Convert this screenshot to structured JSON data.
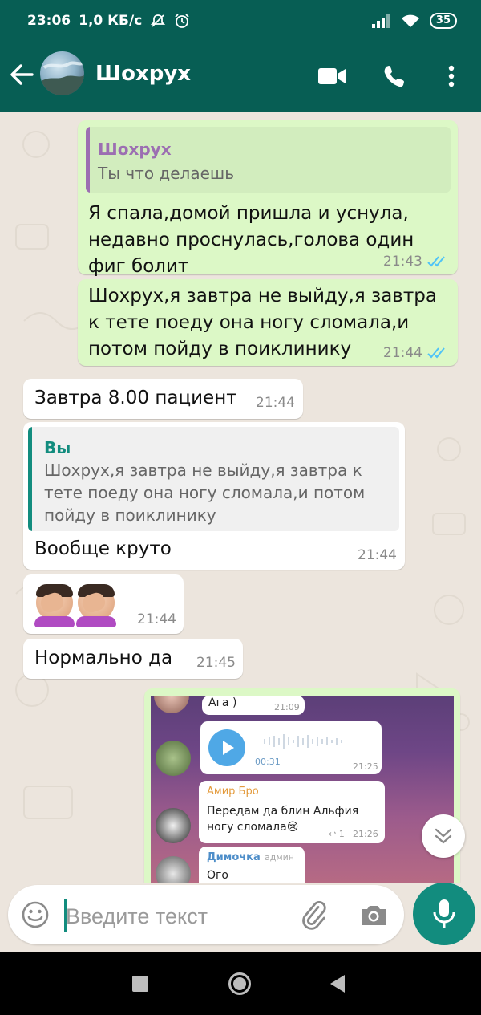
{
  "status_bar": {
    "time": "23:06",
    "speed": "1,0 КБ/с",
    "battery": "35",
    "icons": [
      "muted-bell-icon",
      "alarm-icon",
      "signal-icon",
      "wifi-icon",
      "battery-icon"
    ]
  },
  "header": {
    "contact_name": "Шохрух",
    "icons": [
      "back-arrow-icon",
      "video-call-icon",
      "phone-icon",
      "more-icon"
    ]
  },
  "messages": [
    {
      "direction": "out",
      "quote": {
        "author": "Шохрух",
        "text": "Ты что делаешь"
      },
      "lines": [
        "Я спала,домой пришла и уснула,",
        "недавно проснулась,голова один",
        "фиг болит"
      ],
      "time": "21:43",
      "status": "read"
    },
    {
      "direction": "out",
      "lines": [
        "Шохрух,я завтра не выйду,я завтра",
        "к тете поеду она ногу сломала,и",
        "потом пойду в поиклинику"
      ],
      "time": "21:44",
      "status": "read"
    },
    {
      "direction": "in",
      "text": "Завтра 8.00 пациент",
      "time": "21:44"
    },
    {
      "direction": "in",
      "quote": {
        "author": "Вы",
        "lines": [
          "Шохрух,я завтра не выйду,я завтра к",
          "тете поеду она ногу сломала,и потом",
          "пойду в поиклинику"
        ]
      },
      "text": "Вообще круто",
      "time": "21:44"
    },
    {
      "direction": "in",
      "emoji": [
        "face-palm",
        "face-palm"
      ],
      "time": "21:44"
    },
    {
      "direction": "in",
      "text": "Нормально да",
      "time": "21:45"
    }
  ],
  "forwarded_image": {
    "messages": [
      {
        "text": "Ага )",
        "time": "21:09"
      },
      {
        "voice_duration": "00:31",
        "time": "21:25"
      },
      {
        "author": "Амир Бро",
        "lines": [
          "Передам  да блин Альфия",
          "ногу сломала😢"
        ],
        "reply_count": "1",
        "time": "21:26"
      },
      {
        "author": "Димочка",
        "role": "админ",
        "text": "Ого"
      }
    ],
    "colors": {
      "author_amir": "#E39A3B",
      "author_dima": "#4E8EC9"
    }
  },
  "input": {
    "placeholder": "Введите текст",
    "icons": [
      "emoji-icon",
      "attach-icon",
      "camera-icon",
      "mic-icon"
    ]
  },
  "colors": {
    "header": "#075E54",
    "outgoing": "#DCF8C6",
    "incoming": "#FFFFFF",
    "accent": "#128C7E",
    "read_ticks": "#4FC3F7",
    "quote_purple": "#9C6FB2",
    "quote_green": "#128C7E"
  }
}
